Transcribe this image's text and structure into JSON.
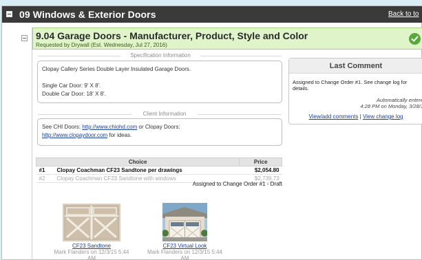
{
  "section": {
    "title": "09 Windows & Exterior Doors",
    "back_link": "Back to to"
  },
  "item": {
    "title": "9.04 Garage Doors - Manufacturer, Product, Style and Color",
    "subtitle": "Requested by Drywall (Est. Wednesday, Jul 27, 2016)"
  },
  "spec": {
    "heading": "Specification Information",
    "line1": "Clopay Callery Series Double Layer Insulated Garage Doors.",
    "line2": "Single Car Door: 9' X 8'.",
    "line3": "Double Car Door: 18' X 8'."
  },
  "client": {
    "heading": "Client Information",
    "text_before": "See CHI Doors: ",
    "link1": "http://www.chiohd.com",
    "text_mid": " or Clopay Doors:",
    "link2": "http://www.clopaydoor.com",
    "text_after": " for ideas."
  },
  "comment": {
    "header": "Last Comment",
    "text": "Assigned to Change Order #1. See change log for details.",
    "auto": "Automatically entere",
    "date": "4:28 PM on Monday, 3/28/1",
    "link_view_add": "View/add comments",
    "separator": "|",
    "link_change_log": "View change log"
  },
  "choices": {
    "headers": [
      "Choice",
      "Price"
    ],
    "rows": [
      {
        "num": "#1",
        "choice": "Clopay Coachman CF23 Sandtone per drawings",
        "price": "$2,054.80"
      },
      {
        "num": "#2",
        "choice": "Clopay Coachman CF23 Sandtone with windows",
        "price": "$2,739.73"
      }
    ],
    "assigned": "Assigned to Change Order #1 - Draft"
  },
  "attachments": [
    {
      "caption": "CF23 Sandtone",
      "author": "Mark Flanders on 12/3/15 5:44",
      "author2": "AM"
    },
    {
      "caption": "CF23 Virtual Look",
      "author": "Mark Flanders on 12/3/15 5:44",
      "author2": "AM"
    }
  ],
  "colors": {
    "header_bg": "#3a3a3a",
    "item_bg": "#dff4c8",
    "accent_green": "#58a83a",
    "link": "#1a3f95"
  }
}
